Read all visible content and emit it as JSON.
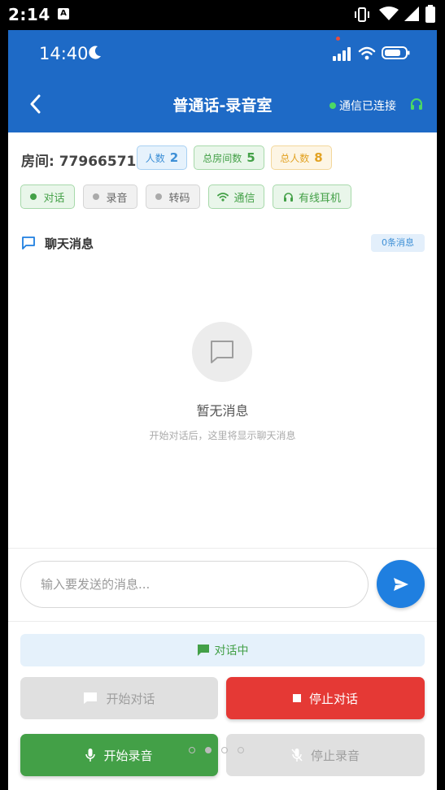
{
  "system": {
    "time": "2:14",
    "notification_badge": "A"
  },
  "device_status": {
    "time": "14:40"
  },
  "header": {
    "title": "普通话-录音室",
    "connection_status": "通信已连接",
    "bg_color": "#1e6ac6"
  },
  "room": {
    "label": "房间: 77966571",
    "people_label": "人数",
    "people_value": "2",
    "rooms_label": "总房间数",
    "rooms_value": "5",
    "total_label": "总人数",
    "total_value": "8"
  },
  "chips": {
    "talk": "对话",
    "record": "录音",
    "transcode": "转码",
    "comm": "通信",
    "headset": "有线耳机"
  },
  "chat": {
    "title": "聊天消息",
    "count": "0条消息",
    "empty_title": "暂无消息",
    "empty_subtitle": "开始对话后，这里将显示聊天消息"
  },
  "input": {
    "placeholder": "输入要发送的消息..."
  },
  "controls": {
    "status_text": "对话中",
    "start_talk": "开始对话",
    "stop_talk": "停止对话",
    "start_record": "开始录音",
    "stop_record": "停止录音"
  },
  "colors": {
    "green": "#43a047",
    "red": "#e53935",
    "blue": "#1f7fe0"
  }
}
